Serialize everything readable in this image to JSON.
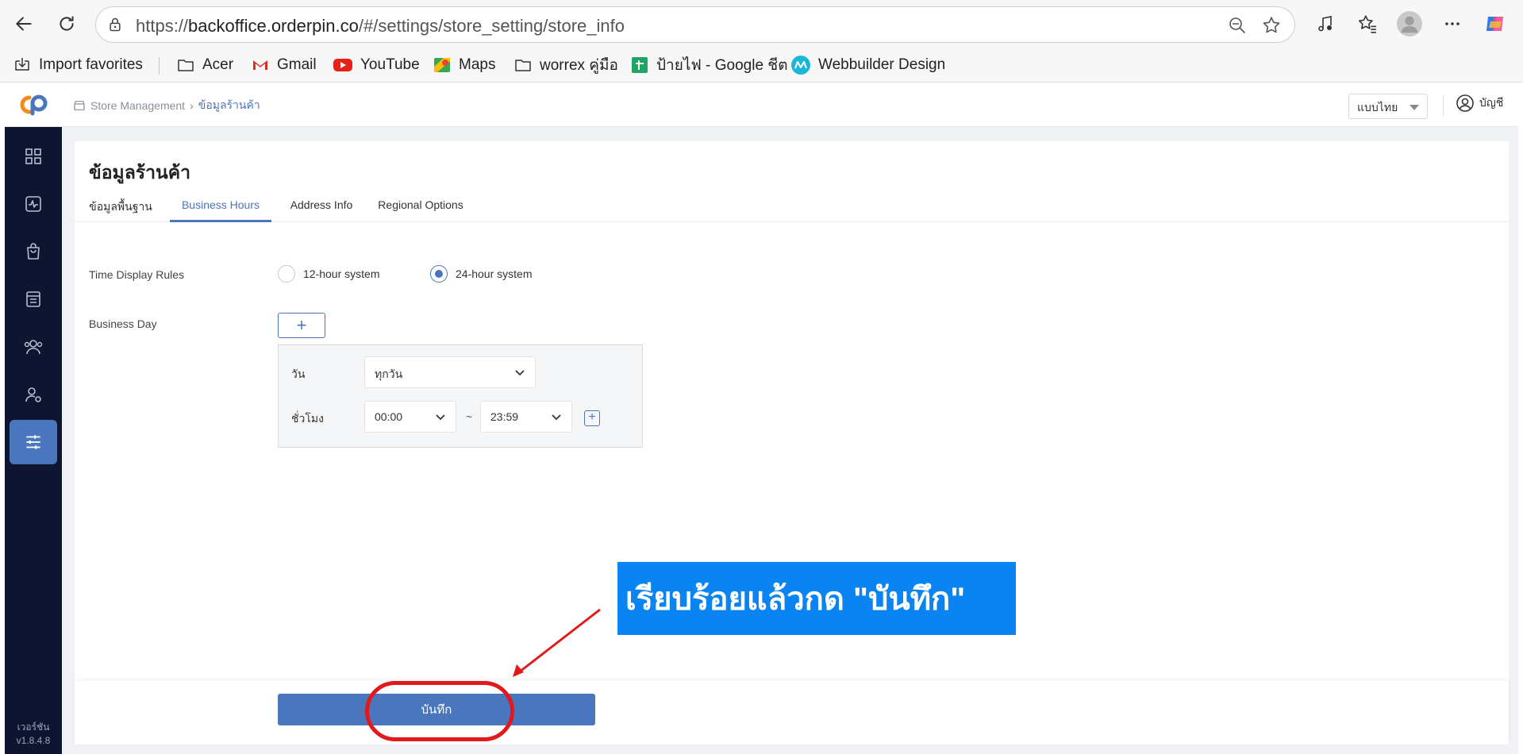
{
  "browser": {
    "url_prefix": "https://",
    "url_domain": "backoffice.orderpin.co",
    "url_path": "/#/settings/store_setting/store_info"
  },
  "bookmarks": [
    {
      "label": "Import favorites",
      "icon": "import-icon"
    },
    {
      "label": "Acer",
      "icon": "folder-icon"
    },
    {
      "label": "Gmail",
      "icon": "gmail-icon"
    },
    {
      "label": "YouTube",
      "icon": "youtube-icon"
    },
    {
      "label": "Maps",
      "icon": "maps-icon"
    },
    {
      "label": "worrex คู่มือ",
      "icon": "folder-icon"
    },
    {
      "label": "ป้ายไฟ - Google ชีต",
      "icon": "sheets-icon"
    },
    {
      "label": "Webbuilder Design",
      "icon": "webbuilder-icon"
    }
  ],
  "sidebar": {
    "items": [
      "dashboard-icon",
      "activity-icon",
      "shopping-bag-icon",
      "store-icon",
      "team-icon",
      "user-settings-icon",
      "sliders-icon"
    ],
    "active_index": 6,
    "version_label": "เวอร์ชัน",
    "version": "v1.8.4.8"
  },
  "topbar": {
    "breadcrumb_root": "Store Management",
    "breadcrumb_current": "ข้อมูลร้านค้า",
    "language": "แบบไทย",
    "account_label": "บัญชี"
  },
  "page": {
    "title": "ข้อมูลร้านค้า",
    "tabs": [
      "ข้อมูลพื้นฐาน",
      "Business Hours",
      "Address Info",
      "Regional Options"
    ],
    "active_tab": 1
  },
  "form": {
    "time_display_label": "Time Display Rules",
    "option_12h": "12-hour system",
    "option_24h": "24-hour system",
    "selected_option": "24-hour system",
    "business_day_label": "Business Day",
    "add_symbol": "+",
    "day_label": "วัน",
    "day_value": "ทุกวัน",
    "hours_label": "ชั่วโมง",
    "start_time": "00:00",
    "end_time": "23:59",
    "range_separator": "~"
  },
  "footer": {
    "save_label": "บันทึก"
  },
  "annotation": {
    "callout_text": "เรียบร้อยแล้วกด \"บันทึก\""
  },
  "colors": {
    "primary": "#4a76be",
    "sidebar_bg": "#0e1530",
    "callout_bg": "#0b84f3",
    "annotation_red": "#e1191b"
  }
}
